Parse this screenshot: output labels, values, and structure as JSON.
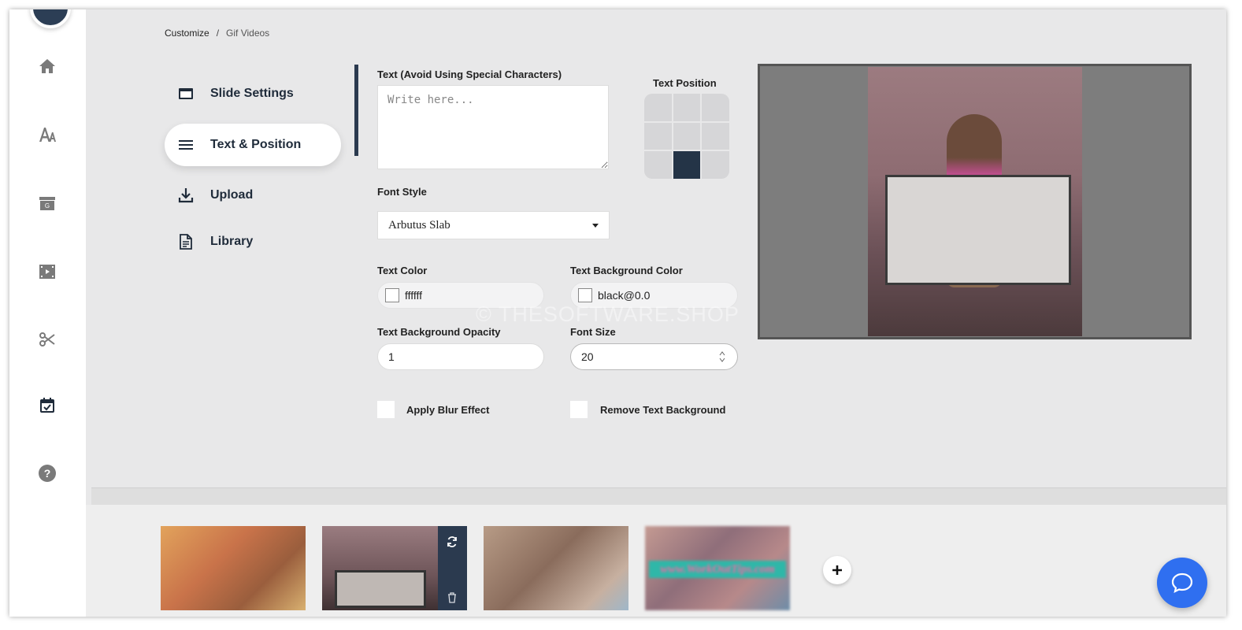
{
  "breadcrumb": {
    "root": "Customize",
    "separator": "/",
    "current": "Gif Videos"
  },
  "menu": [
    {
      "label": "Slide Settings",
      "icon": "slide-icon"
    },
    {
      "label": "Text & Position",
      "icon": "menu-lines-icon",
      "active": true
    },
    {
      "label": "Upload",
      "icon": "download-icon"
    },
    {
      "label": "Library",
      "icon": "document-icon"
    }
  ],
  "sidebar_icons": [
    "home-icon",
    "font-icon",
    "gif-archive-icon",
    "video-film-icon",
    "scissors-icon",
    "calendar-check-icon",
    "help-icon"
  ],
  "form": {
    "text_label": "Text (Avoid Using Special Characters)",
    "text_placeholder": "Write here...",
    "position_label": "Text Position",
    "position_selected": {
      "row": 3,
      "col": 2
    },
    "font_style_label": "Font Style",
    "font_style_value": "Arbutus Slab",
    "text_color_label": "Text Color",
    "text_color_value": "ffffff",
    "text_bg_color_label": "Text Background Color",
    "text_bg_color_value": "black@0.0",
    "bg_opacity_label": "Text Background Opacity",
    "bg_opacity_value": "1",
    "font_size_label": "Font Size",
    "font_size_value": "20",
    "blur_label": "Apply Blur Effect",
    "remove_bg_label": "Remove Text Background"
  },
  "thumbnails": [
    {
      "name": "gif-1"
    },
    {
      "name": "gif-2",
      "selected": true
    },
    {
      "name": "gif-3"
    },
    {
      "name": "gif-4",
      "overlay_text": "www.WorkOutTips.com"
    }
  ],
  "watermark": "© THESOFTWARE.SHOP",
  "colors": {
    "accent": "#243447",
    "chat": "#2f6ff0"
  }
}
